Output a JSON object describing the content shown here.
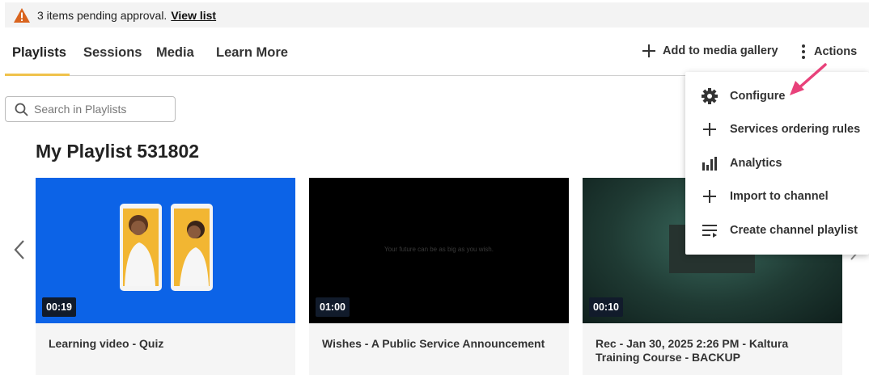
{
  "banner": {
    "message": "3 items pending approval.",
    "link": "View list",
    "icon": "warning-icon",
    "icon_color": "#d9641e"
  },
  "tabs": [
    {
      "label": "Playlists",
      "active": true
    },
    {
      "label": "Sessions"
    },
    {
      "label": "Media"
    },
    {
      "label": "Learn More"
    }
  ],
  "header_actions": {
    "add_media_label": "Add to media gallery",
    "actions_label": "Actions"
  },
  "search": {
    "placeholder": "Search in Playlists",
    "value": ""
  },
  "playlist": {
    "title": "My Playlist 531802"
  },
  "cards": [
    {
      "title": "Learning video - Quiz",
      "duration": "00:19",
      "thumb_color": "#0c63e7"
    },
    {
      "title": "Wishes - A Public Service Announcement",
      "duration": "01:00",
      "thumb_text": "Your future can be as big as you wish.",
      "thumb_color": "#000000"
    },
    {
      "title": "Rec - Jan 30, 2025 2:26 PM - Kaltura Training Course - BACKUP",
      "duration": "00:10",
      "thumb_color": "#1f3a33"
    }
  ],
  "actions_menu": {
    "items": [
      {
        "label": "Configure",
        "icon": "gear-icon"
      },
      {
        "label": "Services ordering rules",
        "icon": "plus-icon"
      },
      {
        "label": "Analytics",
        "icon": "bar-chart-icon"
      },
      {
        "label": "Import to channel",
        "icon": "plus-icon"
      },
      {
        "label": "Create channel playlist",
        "icon": "playlist-icon"
      }
    ]
  },
  "colors": {
    "accent_underline": "#f0c24b",
    "annotation_arrow": "#e8417a"
  }
}
